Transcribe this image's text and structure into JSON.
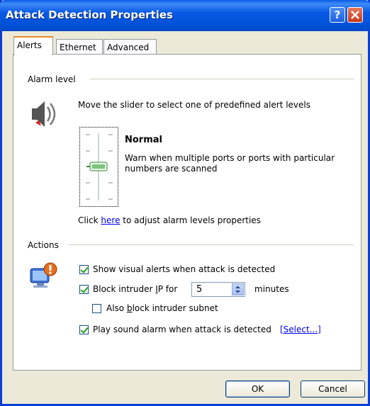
{
  "window": {
    "title": "Attack Detection Properties"
  },
  "tabs": [
    {
      "label": "Alerts",
      "active": true
    },
    {
      "label": "Ethernet",
      "active": false
    },
    {
      "label": "Advanced",
      "active": false
    }
  ],
  "alarm": {
    "section_label": "Alarm level",
    "instruction": "Move the slider to select one of predefined alert levels",
    "level_name": "Normal",
    "level_description": "Warn when multiple ports or ports with particular numbers are scanned",
    "link_prefix": "Click ",
    "link_text": "here",
    "link_suffix": " to adjust alarm levels properties"
  },
  "actions": {
    "section_label": "Actions",
    "show_visual_alerts": {
      "label": "Show visual alerts when attack is detected",
      "checked": true
    },
    "block_intruder_ip": {
      "label_pre": "Block intruder ",
      "label_accel": "I",
      "label_post": "P for",
      "checked": true,
      "minutes_value": "5",
      "minutes_label": "minutes"
    },
    "block_subnet": {
      "label_pre": "Also ",
      "label_accel": "b",
      "label_post": "lock intruder subnet",
      "checked": false
    },
    "play_sound": {
      "label": "Play sound alarm when attack is detected",
      "checked": true,
      "select_link": "[Select...]"
    }
  },
  "buttons": {
    "ok": "OK",
    "cancel": "Cancel"
  },
  "colors": {
    "titlebar": "#0a59e6",
    "dialog_bg": "#ece9d8",
    "tab_accent": "#e68b2c",
    "link": "#0000ee",
    "check": "#21a121"
  }
}
